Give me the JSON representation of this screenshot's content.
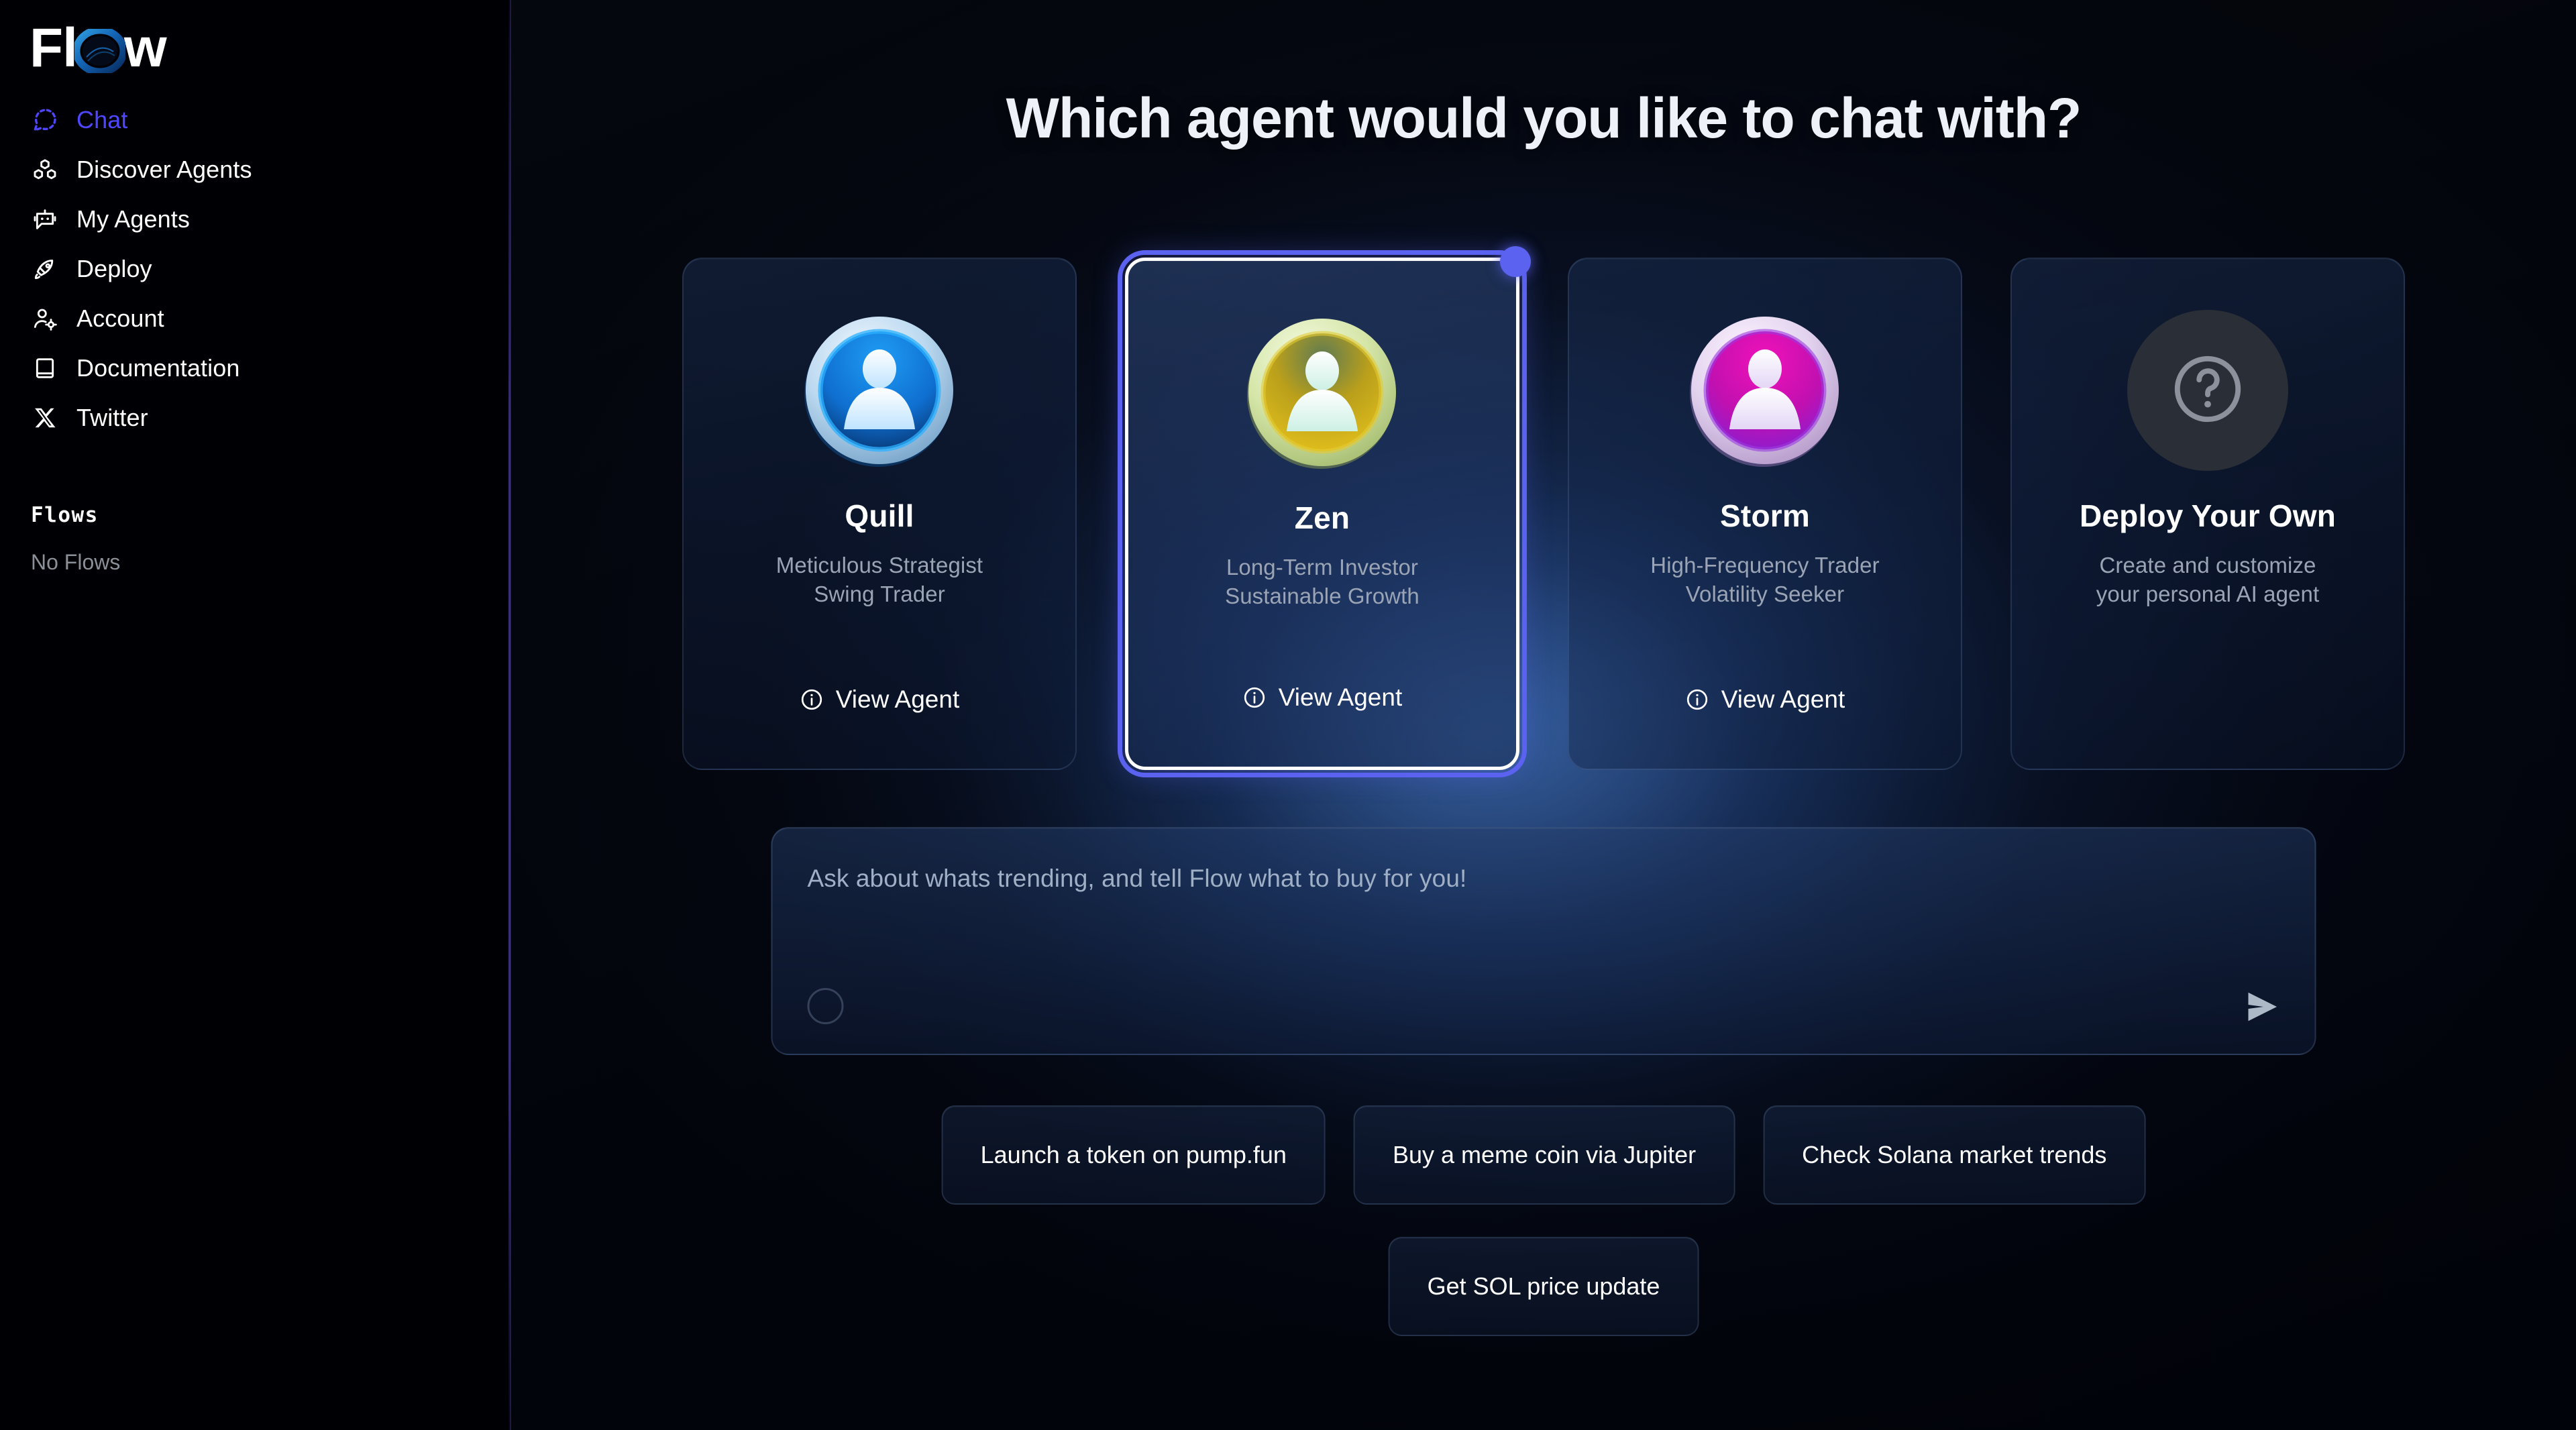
{
  "brand": {
    "logo_text_left": "Fl",
    "logo_text_right": "w",
    "logo_full": "Flow",
    "accent_color": "#4f46ff",
    "selected_dot_color": "#5a62ef"
  },
  "sidebar": {
    "items": [
      {
        "label": "Chat",
        "icon": "chat-bubble-dashed-icon",
        "active": true
      },
      {
        "label": "Discover Agents",
        "icon": "boxes-3d-icon",
        "active": false
      },
      {
        "label": "My Agents",
        "icon": "bot-chat-icon",
        "active": false
      },
      {
        "label": "Deploy",
        "icon": "rocket-icon",
        "active": false
      },
      {
        "label": "Account",
        "icon": "user-gear-icon",
        "active": false
      },
      {
        "label": "Documentation",
        "icon": "book-icon",
        "active": false
      },
      {
        "label": "Twitter",
        "icon": "x-twitter-icon",
        "active": false
      }
    ],
    "flows_section": {
      "heading": "Flows",
      "empty_text": "No Flows"
    }
  },
  "main": {
    "title": "Which agent would you like to chat with?",
    "agents": [
      {
        "name": "Quill",
        "subtitle_line1": "Meticulous Strategist",
        "subtitle_line2": "Swing Trader",
        "action_label": "View Agent",
        "action_icon": "info-circle-icon",
        "avatar_icon": "person-bust-avatar",
        "avatar_color_outer": "#cfe4f5",
        "avatar_color_inner": "#1286e8",
        "selected": false
      },
      {
        "name": "Zen",
        "subtitle_line1": "Long-Term Investor",
        "subtitle_line2": "Sustainable Growth",
        "action_label": "View Agent",
        "action_icon": "info-circle-icon",
        "avatar_icon": "person-bust-avatar",
        "avatar_color_outer": "#d9e8bc",
        "avatar_color_inner": "#d3b516",
        "selected": true
      },
      {
        "name": "Storm",
        "subtitle_line1": "High-Frequency Trader",
        "subtitle_line2": "Volatility Seeker",
        "action_label": "View Agent",
        "action_icon": "info-circle-icon",
        "avatar_icon": "person-bust-avatar",
        "avatar_color_outer": "#dfd2e8",
        "avatar_color_inner": "#d210ab",
        "selected": false
      },
      {
        "name": "Deploy Your Own",
        "subtitle_line1": "Create and customize",
        "subtitle_line2": "your personal AI agent",
        "action_label": "",
        "action_icon": "",
        "avatar_icon": "question-mark-circle-icon",
        "avatar_color_outer": "#2a2e36",
        "avatar_color_inner": "#2a2e36",
        "selected": false
      }
    ],
    "composer": {
      "placeholder": "Ask about whats trending, and tell Flow what to buy for you!",
      "value": "",
      "attach_icon": "circle-icon",
      "send_icon": "send-arrow-icon"
    },
    "suggestions_row1": [
      "Launch a token on pump.fun",
      "Buy a meme coin via Jupiter",
      "Check Solana market trends"
    ],
    "suggestions_row2": [
      "Get SOL price update"
    ]
  }
}
